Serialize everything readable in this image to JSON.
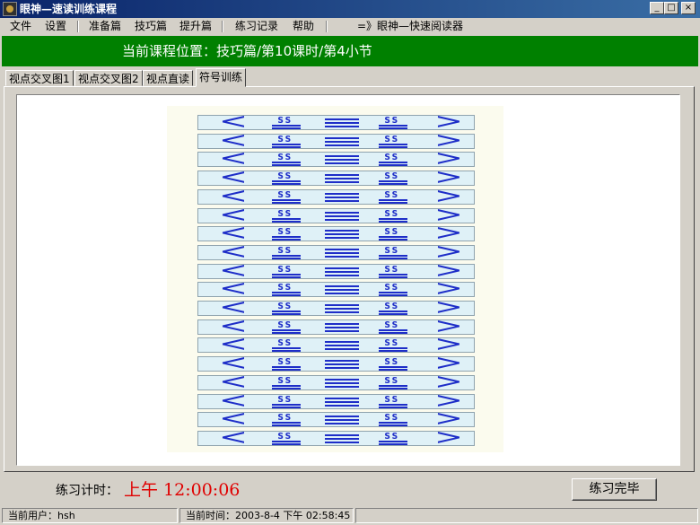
{
  "window": {
    "title": "眼神—速读训练课程",
    "min_glyph": "_",
    "max_glyph": "□",
    "close_glyph": "×"
  },
  "menu": {
    "items": [
      "文件",
      "设置",
      "准备篇",
      "技巧篇",
      "提升篇",
      "练习记录",
      "帮助",
      "=》眼神—快速阅读器"
    ]
  },
  "banner": {
    "text": "当前课程位置：技巧篇/第10课时/第4小节",
    "color": "#008000"
  },
  "tabs": [
    {
      "label": "视点交叉图1",
      "active": false
    },
    {
      "label": "视点交叉图2",
      "active": false
    },
    {
      "label": "视点直读",
      "active": false
    },
    {
      "label": "符号训练",
      "active": true
    }
  ],
  "exercise": {
    "row_count": 18,
    "symbols": [
      "<",
      "s-underlined",
      "≡",
      "s-underlined",
      ">"
    ],
    "symbol_color": "#1e2ec8",
    "strip_color": "#dff1f7"
  },
  "timer": {
    "label": "练习计时：",
    "value": "上午 12:00:06"
  },
  "finish_button": {
    "label": "练习完毕"
  },
  "status": {
    "user": "当前用户：hsh",
    "time": "当前时间：2003-8-4 下午 02:58:45"
  }
}
